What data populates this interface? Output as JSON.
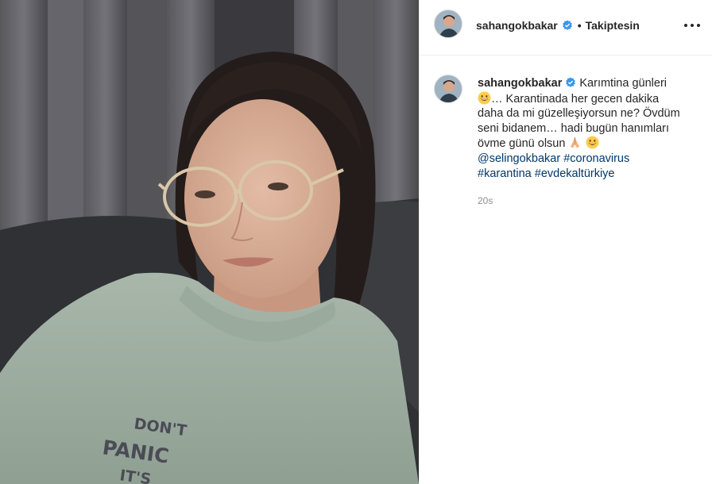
{
  "post": {
    "username": "sahangokbakar",
    "verified": true,
    "follow_status": "Takiptesin",
    "separator": "•",
    "more_icon": "more-horizontal-icon",
    "accent_link_color": "#00376b",
    "verified_color": "#3897f0"
  },
  "caption": {
    "username": "sahangokbakar",
    "segments": {
      "s1": "Karımtina günleri",
      "e1": "grinning-face-emoji",
      "s2": "… Karantinada her gecen dakika daha da mi güzelleşiyorsun ne? Övdüm seni bidanem… hadi bugün hanımları övme günü olsun",
      "e2": "folded-hands-emoji",
      "e3": "grinning-face-emoji",
      "mention": "@selingokbakar",
      "tag1": "#coronavirus",
      "tag2": "#karantina",
      "tag3": "#evdekaltürkiye"
    },
    "timestamp": "20s"
  },
  "photo": {
    "sweater_text": "DON'T PANIC"
  }
}
